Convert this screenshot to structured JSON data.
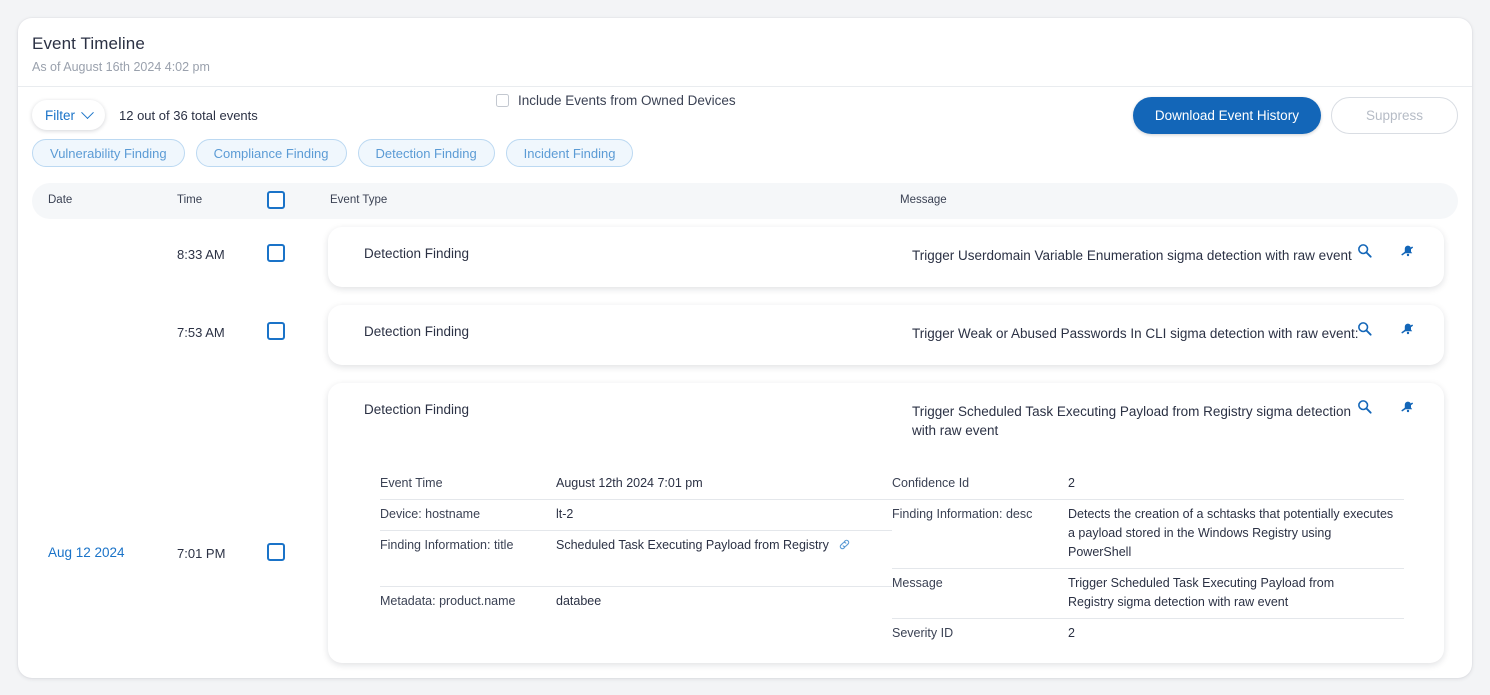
{
  "header": {
    "title": "Event Timeline",
    "subtitle": "As of August 16th 2024 4:02 pm"
  },
  "toolbar": {
    "filter_label": "Filter",
    "count_text": "12 out of 36 total events",
    "owned_devices_label": "Include Events from Owned Devices",
    "download_label": "Download Event History",
    "suppress_label": "Suppress",
    "primary_color": "#1366b8",
    "link_color": "#1a73c8"
  },
  "filter_pills": [
    {
      "label": "Vulnerability Finding"
    },
    {
      "label": "Compliance Finding"
    },
    {
      "label": "Detection Finding"
    },
    {
      "label": "Incident Finding"
    }
  ],
  "table": {
    "columns": {
      "date": "Date",
      "time": "Time",
      "event_type": "Event Type",
      "message": "Message"
    }
  },
  "rows": [
    {
      "date": "",
      "time": "8:33 AM",
      "event_type": "Detection Finding",
      "message": "Trigger Userdomain Variable Enumeration sigma detection with raw event",
      "expanded": false
    },
    {
      "date": "",
      "time": "7:53 AM",
      "event_type": "Detection Finding",
      "message": "Trigger Weak or Abused Passwords In CLI sigma detection with raw event:",
      "expanded": false
    },
    {
      "date": "Aug 12 2024",
      "time": "7:01 PM",
      "event_type": "Detection Finding",
      "message": "Trigger Scheduled Task Executing Payload from Registry sigma detection with raw event",
      "expanded": true,
      "detail_left": [
        {
          "key": "Event Time",
          "value": "August 12th 2024 7:01 pm"
        },
        {
          "key": "Device: hostname",
          "value": "lt-2"
        },
        {
          "key": "Finding Information: title",
          "value": "Scheduled Task Executing Payload from Registry",
          "has_link_icon": true
        },
        {
          "key": "Metadata: product.name",
          "value": "databee"
        }
      ],
      "detail_right": [
        {
          "key": "Confidence Id",
          "value": "2"
        },
        {
          "key": "Finding Information: desc",
          "value": "Detects the creation of a schtasks that potentially executes a payload stored in the Windows Registry using PowerShell"
        },
        {
          "key": "Message",
          "value": "Trigger Scheduled Task Executing Payload from Registry sigma detection with raw event"
        },
        {
          "key": "Severity ID",
          "value": "2"
        }
      ]
    }
  ],
  "icons": {
    "search": "search-icon",
    "mute": "bell-slash-icon",
    "link": "link-icon",
    "chevron": "chevron-down-icon"
  }
}
